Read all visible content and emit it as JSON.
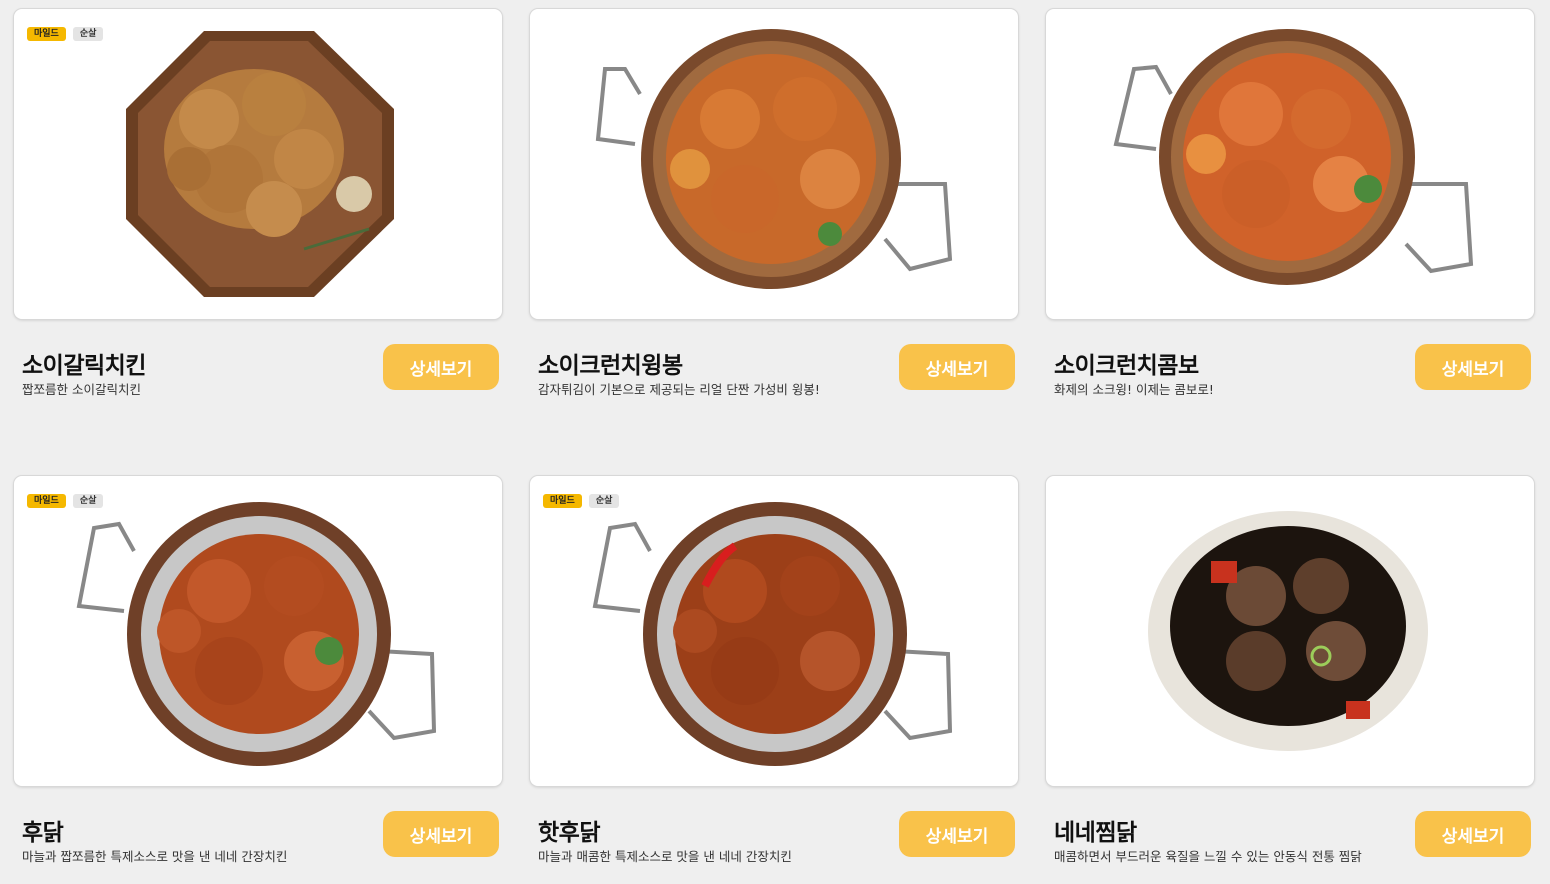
{
  "tags": {
    "mild": "마일드",
    "boneless": "순살"
  },
  "detail_label": "상세보기",
  "products": [
    {
      "name": "소이갈릭치킨",
      "desc": "짭쪼름한 소이갈릭치킨",
      "tags": [
        "마일드",
        "순살"
      ],
      "image": "fried-chicken-octagon-plate"
    },
    {
      "name": "소이크런치윙봉",
      "desc": "감자튀김이 기본으로 제공되는 리얼 단짠 가성비 윙봉!",
      "tags": [],
      "image": "wings-in-pan"
    },
    {
      "name": "소이크런치콤보",
      "desc": "화제의 소크윙! 이제는 콤보로!",
      "tags": [],
      "image": "combo-in-pan"
    },
    {
      "name": "후닭",
      "desc": "마늘과 짭쪼름한 특제소스로 맛을 낸 네네 간장치킨",
      "tags": [
        "마일드",
        "순살"
      ],
      "image": "glazed-chicken-pan"
    },
    {
      "name": "핫후닭",
      "desc": "마늘과 매콤한 특제소스로 맛을 낸 네네 간장치킨",
      "tags": [
        "마일드",
        "순살"
      ],
      "image": "spicy-chicken-pan"
    },
    {
      "name": "네네찜닭",
      "desc": "매콤하면서 부드러운 육질을 느낄 수 있는 안동식 전통 찜닭",
      "tags": [],
      "image": "braised-chicken-bowl"
    }
  ]
}
